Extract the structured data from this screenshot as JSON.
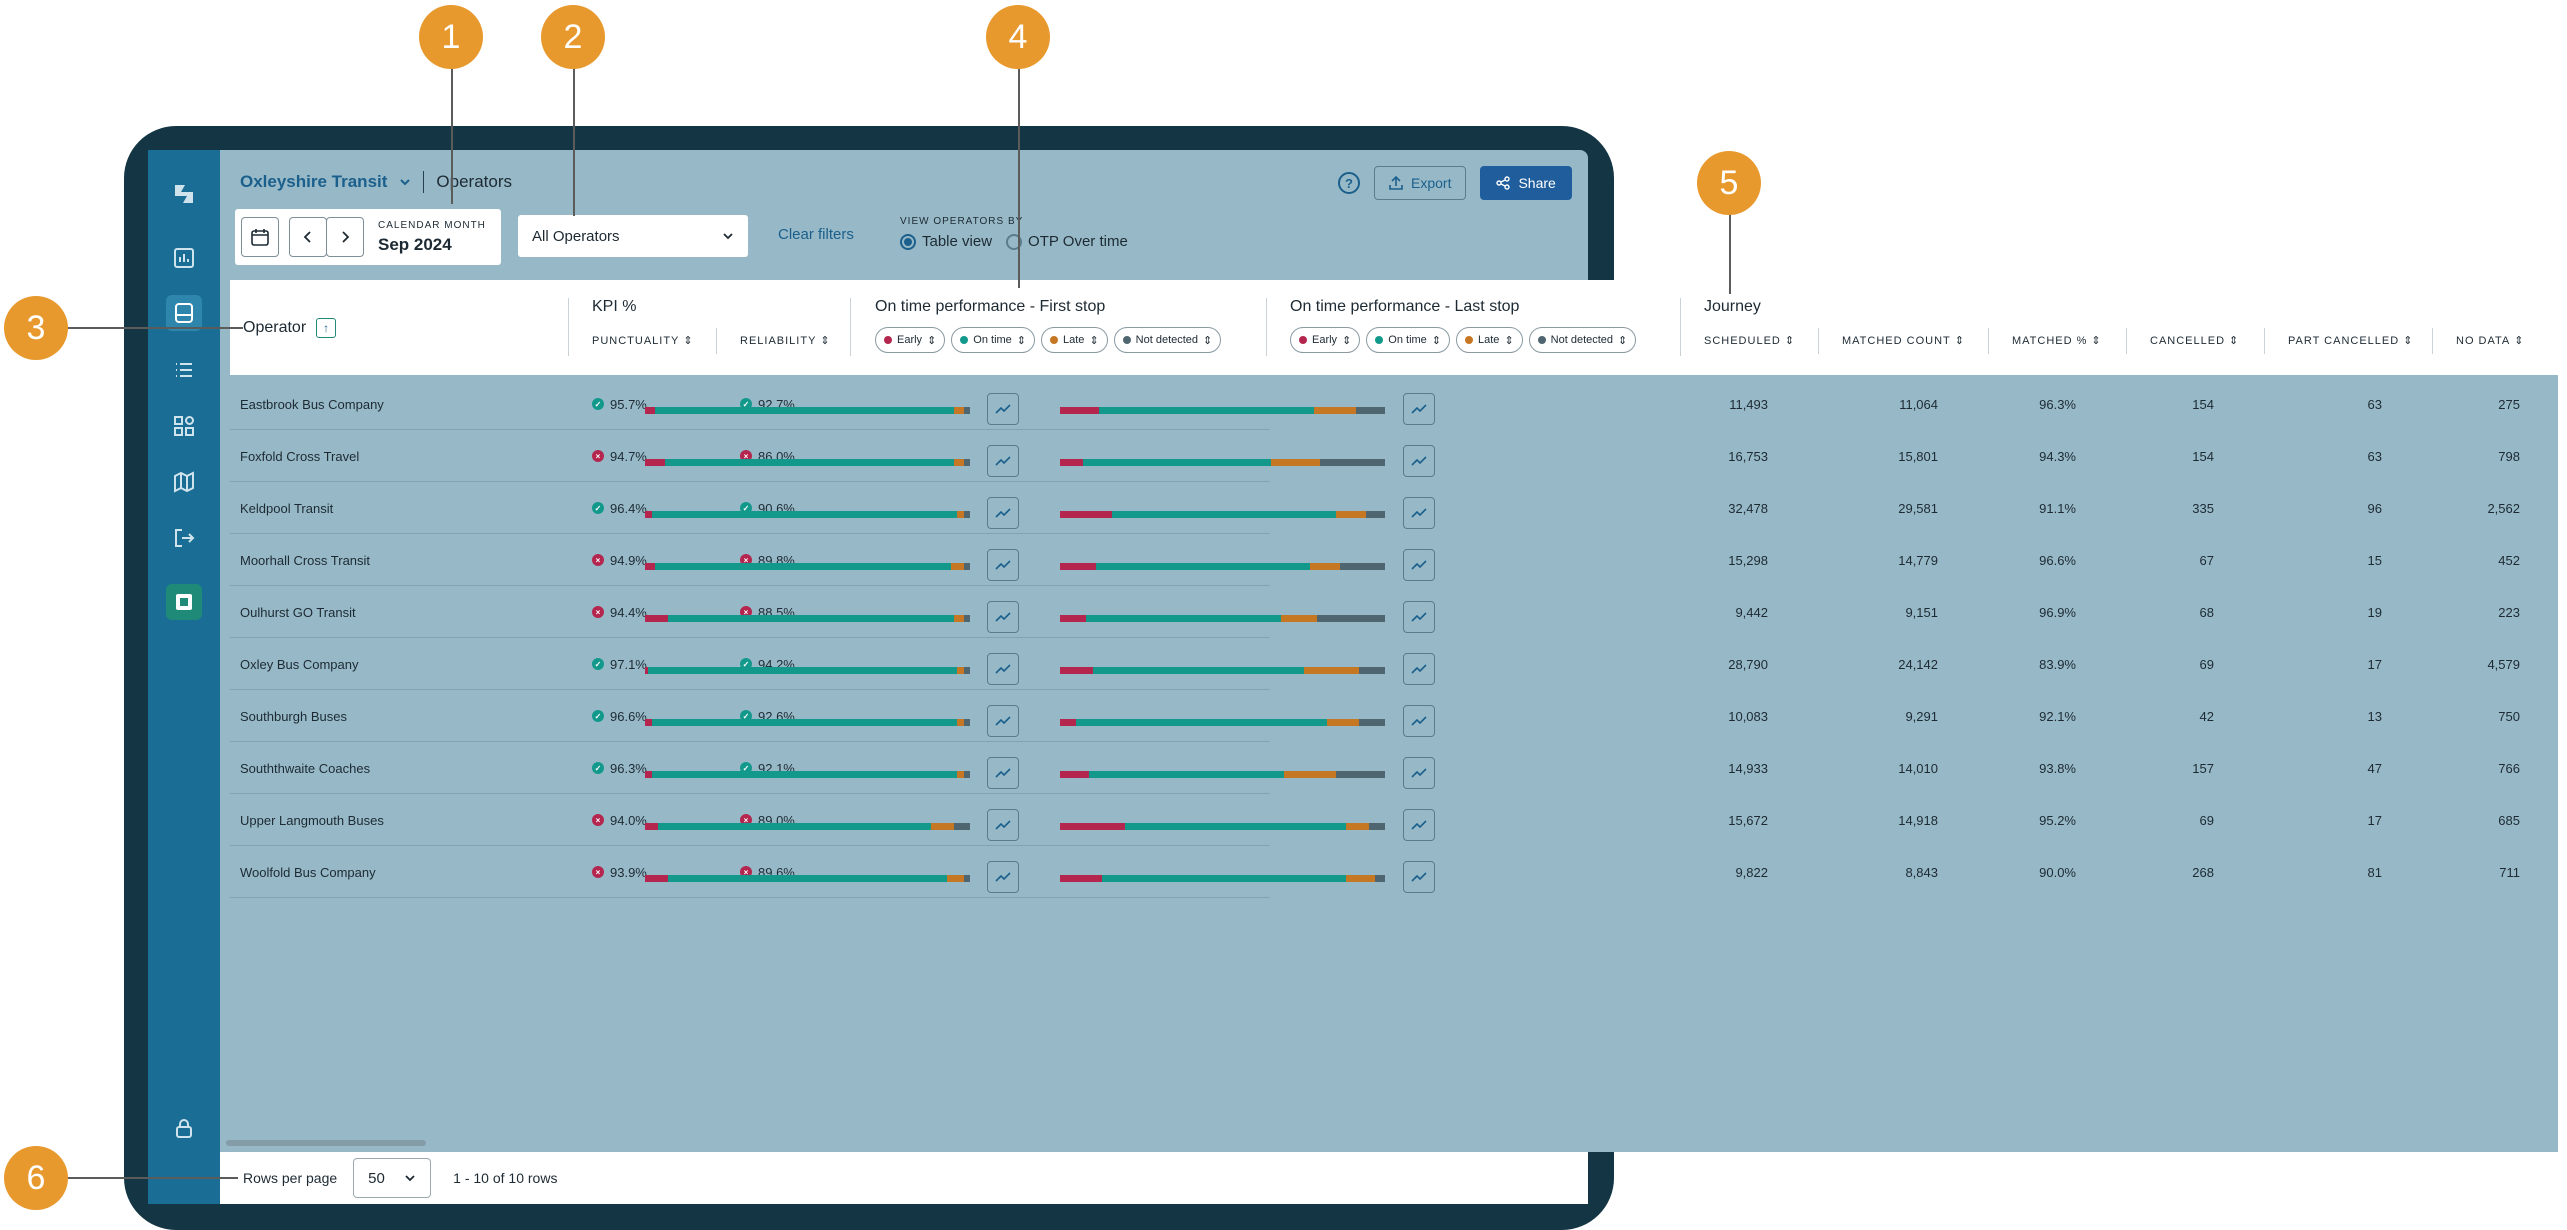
{
  "header": {
    "brand": "Oxleyshire Transit",
    "page_title": "Operators",
    "help": "?",
    "export_label": "Export",
    "share_label": "Share"
  },
  "filters": {
    "calendar_label": "CALENDAR MONTH",
    "month": "Sep 2024",
    "operator_select": "All Operators",
    "clear": "Clear filters",
    "view_by_label": "VIEW OPERATORS BY",
    "view_table": "Table view",
    "view_otp": "OTP Over time"
  },
  "table": {
    "operator_header": "Operator",
    "kpi_group": "KPI %",
    "punctuality": "PUNCTUALITY",
    "reliability": "RELIABILITY",
    "otp_first": "On time performance - First stop",
    "otp_last": "On time performance - Last stop",
    "chips": [
      "Early",
      "On time",
      "Late",
      "Not detected"
    ],
    "journey_group": "Journey",
    "journey_cols": [
      "SCHEDULED",
      "MATCHED COUNT",
      "MATCHED %",
      "CANCELLED",
      "PART CANCELLED",
      "NO DATA"
    ],
    "rows": [
      {
        "name": "Eastbrook Bus Company",
        "punct": "95.7%",
        "punct_ok": true,
        "rel": "92.7%",
        "rel_ok": true,
        "first": [
          3,
          92,
          3,
          2
        ],
        "last": [
          12,
          66,
          13,
          9
        ],
        "sched": "11,493",
        "matched": "11,064",
        "pct": "96.3%",
        "cancelled": "154",
        "part": "63",
        "nodata": "275"
      },
      {
        "name": "Foxfold Cross Travel",
        "punct": "94.7%",
        "punct_ok": false,
        "rel": "86.0%",
        "rel_ok": false,
        "first": [
          6,
          89,
          3,
          2
        ],
        "last": [
          7,
          58,
          15,
          20
        ],
        "sched": "16,753",
        "matched": "15,801",
        "pct": "94.3%",
        "cancelled": "154",
        "part": "63",
        "nodata": "798"
      },
      {
        "name": "Keldpool Transit",
        "punct": "96.4%",
        "punct_ok": true,
        "rel": "90.6%",
        "rel_ok": true,
        "first": [
          2,
          94,
          2,
          2
        ],
        "last": [
          16,
          69,
          9,
          6
        ],
        "sched": "32,478",
        "matched": "29,581",
        "pct": "91.1%",
        "cancelled": "335",
        "part": "96",
        "nodata": "2,562"
      },
      {
        "name": "Moorhall Cross Transit",
        "punct": "94.9%",
        "punct_ok": false,
        "rel": "89.8%",
        "rel_ok": false,
        "first": [
          3,
          91,
          4,
          2
        ],
        "last": [
          11,
          66,
          9,
          14
        ],
        "sched": "15,298",
        "matched": "14,779",
        "pct": "96.6%",
        "cancelled": "67",
        "part": "15",
        "nodata": "452"
      },
      {
        "name": "Oulhurst GO Transit",
        "punct": "94.4%",
        "punct_ok": false,
        "rel": "88.5%",
        "rel_ok": false,
        "first": [
          7,
          88,
          3,
          2
        ],
        "last": [
          8,
          60,
          11,
          21
        ],
        "sched": "9,442",
        "matched": "9,151",
        "pct": "96.9%",
        "cancelled": "68",
        "part": "19",
        "nodata": "223"
      },
      {
        "name": "Oxley Bus Company",
        "punct": "97.1%",
        "punct_ok": true,
        "rel": "94.2%",
        "rel_ok": true,
        "first": [
          1,
          95,
          2,
          2
        ],
        "last": [
          10,
          65,
          17,
          8
        ],
        "sched": "28,790",
        "matched": "24,142",
        "pct": "83.9%",
        "cancelled": "69",
        "part": "17",
        "nodata": "4,579"
      },
      {
        "name": "Southburgh Buses",
        "punct": "96.6%",
        "punct_ok": true,
        "rel": "92.6%",
        "rel_ok": true,
        "first": [
          2,
          94,
          2,
          2
        ],
        "last": [
          5,
          77,
          10,
          8
        ],
        "sched": "10,083",
        "matched": "9,291",
        "pct": "92.1%",
        "cancelled": "42",
        "part": "13",
        "nodata": "750"
      },
      {
        "name": "Souththwaite Coaches",
        "punct": "96.3%",
        "punct_ok": true,
        "rel": "92.1%",
        "rel_ok": true,
        "first": [
          2,
          94,
          2,
          2
        ],
        "last": [
          9,
          60,
          16,
          15
        ],
        "sched": "14,933",
        "matched": "14,010",
        "pct": "93.8%",
        "cancelled": "157",
        "part": "47",
        "nodata": "766"
      },
      {
        "name": "Upper Langmouth Buses",
        "punct": "94.0%",
        "punct_ok": false,
        "rel": "89.0%",
        "rel_ok": false,
        "first": [
          4,
          84,
          7,
          5
        ],
        "last": [
          20,
          68,
          7,
          5
        ],
        "sched": "15,672",
        "matched": "14,918",
        "pct": "95.2%",
        "cancelled": "69",
        "part": "17",
        "nodata": "685"
      },
      {
        "name": "Woolfold Bus Company",
        "punct": "93.9%",
        "punct_ok": false,
        "rel": "89.6%",
        "rel_ok": false,
        "first": [
          7,
          86,
          5,
          2
        ],
        "last": [
          13,
          75,
          9,
          3
        ],
        "sched": "9,822",
        "matched": "8,843",
        "pct": "90.0%",
        "cancelled": "268",
        "part": "81",
        "nodata": "711"
      }
    ]
  },
  "footer": {
    "rows_per_page_label": "Rows per page",
    "rows_per_page": "50",
    "range": "1 - 10 of 10 rows"
  },
  "callouts": [
    "1",
    "2",
    "3",
    "4",
    "5",
    "6"
  ],
  "colors": {
    "early": "#b5264f",
    "on_time": "#13998b",
    "late": "#c67724",
    "not_detected": "#4f6570",
    "accent": "#e8992e",
    "brand": "#1b5f8c"
  }
}
